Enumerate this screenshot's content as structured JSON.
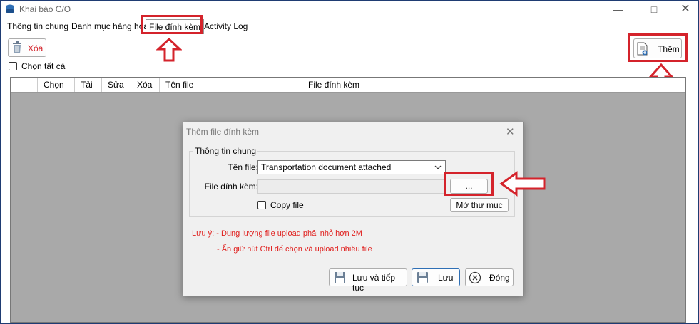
{
  "window": {
    "title": "Khai báo C/O"
  },
  "tabs": [
    {
      "label": "Thông tin chung"
    },
    {
      "label": "Danh mục hàng hóa"
    },
    {
      "label": "File đính kèm"
    },
    {
      "label": "Activity Log"
    }
  ],
  "toolbar": {
    "delete_label": "Xóa",
    "select_all_label": "Chọn tất cả",
    "add_label": "Thêm"
  },
  "grid": {
    "columns": [
      "",
      "Chọn",
      "Tải",
      "Sửa",
      "Xóa",
      "Tên file",
      "File đính kèm"
    ]
  },
  "dialog": {
    "title": "Thêm file đính kèm",
    "group_title": "Thông tin chung",
    "file_name_label": "Tên file:",
    "file_name_value": "Transportation document attached",
    "attachment_label": "File đính kèm:",
    "browse_label": "...",
    "copy_file_label": "Copy file",
    "open_folder_label": "Mở thư mục",
    "note_line1": "Lưu ý:  - Dung lượng file upload phải nhỏ hơn 2M",
    "note_line2": "- Ấn giữ nút Ctrl để chọn và upload nhiều file",
    "save_continue_label": "Lưu và tiếp tục",
    "save_label": "Lưu",
    "close_label": "Đóng"
  },
  "colors": {
    "annotation_red": "#d4232b",
    "note_red": "#e0201e",
    "grid_bg": "#a9a9a9"
  },
  "icons": [
    "app-icon",
    "minimize-icon",
    "maximize-icon",
    "close-icon",
    "trash-icon",
    "add-document-icon",
    "up-arrow-annotation-icon",
    "left-arrow-annotation-icon",
    "dropdown-chevron-icon",
    "save-icon",
    "cancel-icon"
  ]
}
